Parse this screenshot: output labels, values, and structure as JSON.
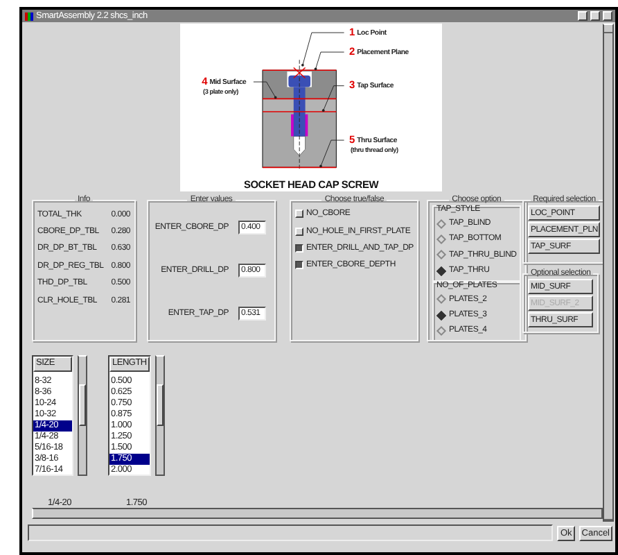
{
  "window": {
    "title": "SmartAssembly 2.2 shcs_inch"
  },
  "diagram": {
    "callouts": [
      {
        "number": "1",
        "label": "Loc Point"
      },
      {
        "number": "2",
        "label": "Placement Plane"
      },
      {
        "number": "4",
        "label": "Mid Surface",
        "note": "(3 plate only)"
      },
      {
        "number": "3",
        "label": "Tap Surface"
      },
      {
        "number": "5",
        "label": "Thru Surface",
        "note": "(thru thread only)"
      }
    ],
    "caption": "SOCKET HEAD CAP SCREW"
  },
  "info": {
    "title": "Info",
    "rows": [
      {
        "name": "TOTAL_THK",
        "value": "0.000"
      },
      {
        "name": "CBORE_DP_TBL",
        "value": "0.280"
      },
      {
        "name": "DR_DP_BT_TBL",
        "value": "0.630"
      },
      {
        "name": "DR_DP_REG_TBL",
        "value": "0.800"
      },
      {
        "name": "THD_DP_TBL",
        "value": "0.500"
      },
      {
        "name": "CLR_HOLE_TBL",
        "value": "0.281"
      }
    ]
  },
  "enter_values": {
    "title": "Enter values",
    "fields": [
      {
        "label": "ENTER_CBORE_DP",
        "value": "0.400"
      },
      {
        "label": "ENTER_DRILL_DP",
        "value": "0.800"
      },
      {
        "label": "ENTER_TAP_DP",
        "value": "0.531"
      }
    ]
  },
  "choose_true_false": {
    "title": "Choose true/false",
    "options": [
      {
        "label": "NO_CBORE",
        "checked": false
      },
      {
        "label": "NO_HOLE_IN_FIRST_PLATE",
        "checked": false
      },
      {
        "label": "ENTER_DRILL_AND_TAP_DP",
        "checked": true
      },
      {
        "label": "ENTER_CBORE_DEPTH",
        "checked": true
      }
    ]
  },
  "choose_option": {
    "title": "Choose option",
    "groups": [
      {
        "title": "TAP_STYLE",
        "options": [
          {
            "label": "TAP_BLIND",
            "selected": false
          },
          {
            "label": "TAP_BOTTOM",
            "selected": false
          },
          {
            "label": "TAP_THRU_BLIND",
            "selected": false
          },
          {
            "label": "TAP_THRU",
            "selected": true
          }
        ]
      },
      {
        "title": "NO_OF_PLATES",
        "options": [
          {
            "label": "PLATES_2",
            "selected": false
          },
          {
            "label": "PLATES_3",
            "selected": true
          },
          {
            "label": "PLATES_4",
            "selected": false
          }
        ]
      }
    ]
  },
  "required_selection": {
    "title": "Required selection",
    "buttons": [
      {
        "label": "LOC_POINT",
        "disabled": false
      },
      {
        "label": "PLACEMENT_PLN",
        "disabled": false
      },
      {
        "label": "TAP_SURF",
        "disabled": false
      }
    ]
  },
  "optional_selection": {
    "title": "Optional selection",
    "buttons": [
      {
        "label": "MID_SURF",
        "disabled": false
      },
      {
        "label": "MID_SURF_2",
        "disabled": true
      },
      {
        "label": "THRU_SURF",
        "disabled": false
      }
    ]
  },
  "lists": [
    {
      "header": "SIZE",
      "value": "1/4-20",
      "items": [
        {
          "label": "8-32",
          "selected": false
        },
        {
          "label": "8-36",
          "selected": false
        },
        {
          "label": "10-24",
          "selected": false
        },
        {
          "label": "10-32",
          "selected": false
        },
        {
          "label": "1/4-20",
          "selected": true
        },
        {
          "label": "1/4-28",
          "selected": false
        },
        {
          "label": "5/16-18",
          "selected": false
        },
        {
          "label": "3/8-16",
          "selected": false
        },
        {
          "label": "7/16-14",
          "selected": false
        }
      ]
    },
    {
      "header": "LENGTH",
      "value": "1.750",
      "items": [
        {
          "label": "0.500",
          "selected": false
        },
        {
          "label": "0.625",
          "selected": false
        },
        {
          "label": "0.750",
          "selected": false
        },
        {
          "label": "0.875",
          "selected": false
        },
        {
          "label": "1.000",
          "selected": false
        },
        {
          "label": "1.250",
          "selected": false
        },
        {
          "label": "1.500",
          "selected": false
        },
        {
          "label": "1.750",
          "selected": true
        },
        {
          "label": "2.000",
          "selected": false
        }
      ]
    }
  ],
  "buttons": [
    "Ok",
    "Cancel"
  ]
}
